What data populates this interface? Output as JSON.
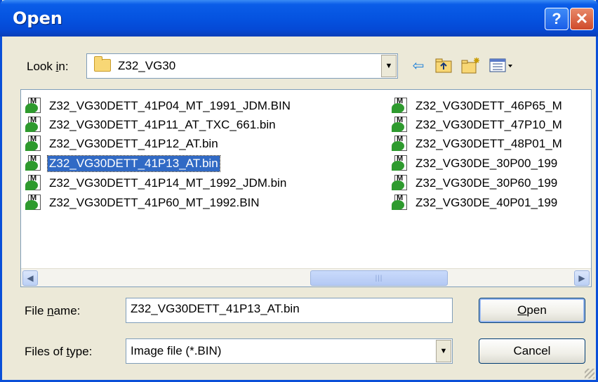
{
  "window": {
    "title": "Open",
    "help_glyph": "?",
    "close_glyph": "✕"
  },
  "look_in": {
    "label_pre": "Look ",
    "label_underlined": "i",
    "label_post": "n:",
    "folder": "Z32_VG30",
    "icons": [
      "back-arrow-icon",
      "up-folder-icon",
      "new-folder-icon",
      "view-menu-icon"
    ]
  },
  "files": [
    {
      "name": "Z32_VG30DETT_41P04_MT_1991_JDM.BIN",
      "selected": false
    },
    {
      "name": "Z32_VG30DETT_41P11_AT_TXC_661.bin",
      "selected": false
    },
    {
      "name": "Z32_VG30DETT_41P12_AT.bin",
      "selected": false
    },
    {
      "name": "Z32_VG30DETT_41P13_AT.bin",
      "selected": true
    },
    {
      "name": "Z32_VG30DETT_41P14_MT_1992_JDM.bin",
      "selected": false
    },
    {
      "name": "Z32_VG30DETT_41P60_MT_1992.BIN",
      "selected": false
    },
    {
      "name": "Z32_VG30DETT_46P65_M",
      "selected": false
    },
    {
      "name": "Z32_VG30DETT_47P10_M",
      "selected": false
    },
    {
      "name": "Z32_VG30DETT_48P01_M",
      "selected": false
    },
    {
      "name": "Z32_VG30DE_30P00_199",
      "selected": false
    },
    {
      "name": "Z32_VG30DE_30P60_199",
      "selected": false
    },
    {
      "name": "Z32_VG30DE_40P01_199",
      "selected": false
    }
  ],
  "scrollbar": {
    "left_glyph": "◀",
    "right_glyph": "▶",
    "thumb_grip": "|||"
  },
  "filename": {
    "label_pre": "File ",
    "label_underlined": "n",
    "label_post": "ame:",
    "value": "Z32_VG30DETT_41P13_AT.bin"
  },
  "filetype": {
    "label_pre": "Files of ",
    "label_underlined": "t",
    "label_post": "ype:",
    "value": "Image file (*.BIN)"
  },
  "buttons": {
    "open_underlined": "O",
    "open_rest": "pen",
    "cancel": "Cancel"
  }
}
